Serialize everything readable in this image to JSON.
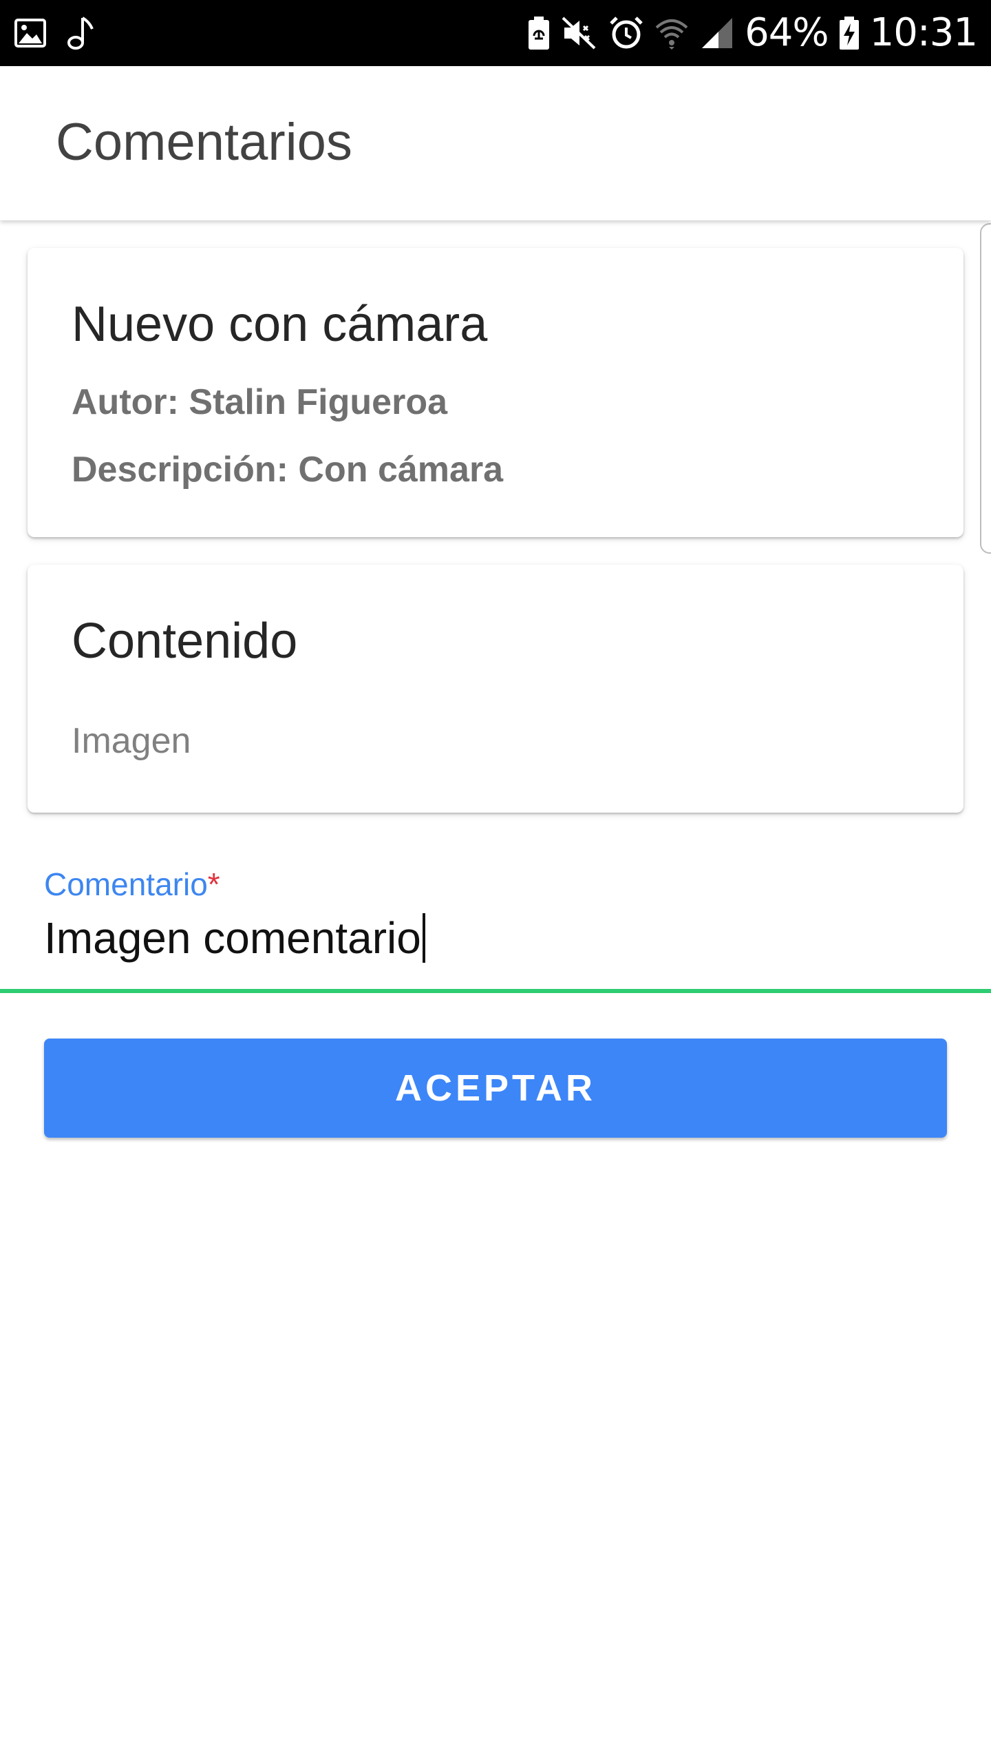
{
  "status_bar": {
    "battery_percent": "64%",
    "time": "10:31",
    "icons": [
      "gallery-icon",
      "music-note-icon",
      "battery-saver-icon",
      "mute-icon",
      "alarm-icon",
      "wifi-icon",
      "signal-icon",
      "battery-charging-icon"
    ]
  },
  "app_bar": {
    "title": "Comentarios"
  },
  "post_card": {
    "title": "Nuevo con cámara",
    "author": "Autor: Stalin Figueroa",
    "description": "Descripción: Con cámara"
  },
  "content_card": {
    "title": "Contenido",
    "type": "Imagen"
  },
  "comment_field": {
    "label": "Comentario",
    "required_marker": "*",
    "value": "Imagen comentario"
  },
  "actions": {
    "accept_label": "ACEPTAR"
  },
  "colors": {
    "accent": "#3d86f8",
    "label": "#3d86f0",
    "required": "#e0333d",
    "underline": "#2ecc71"
  }
}
